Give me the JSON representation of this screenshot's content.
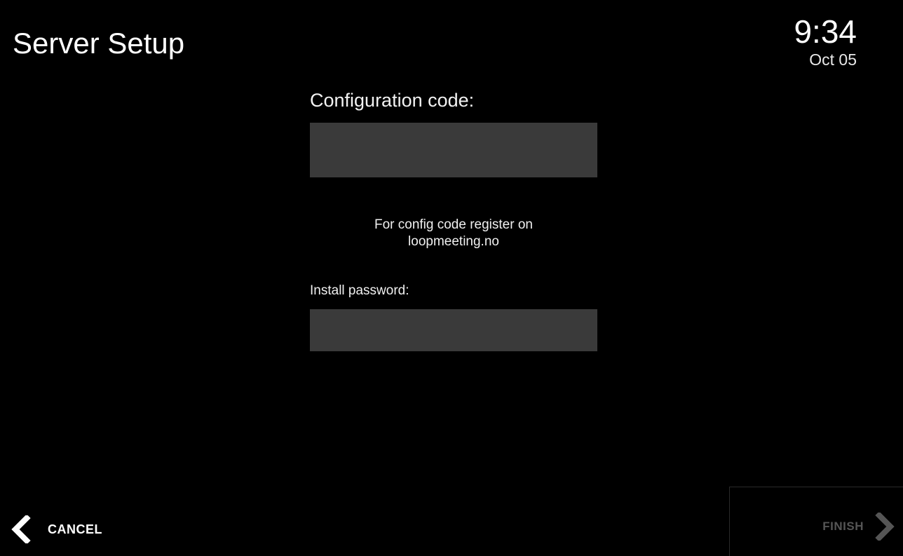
{
  "header": {
    "title": "Server Setup",
    "time": "9:34",
    "date": "Oct 05"
  },
  "form": {
    "config_label": "Configuration code:",
    "config_value": "",
    "hint_line1": "For config code register on",
    "hint_line2": "loopmeeting.no",
    "password_label": "Install password:",
    "password_value": ""
  },
  "footer": {
    "cancel_label": "CANCEL",
    "cancel_icon": "chevron-left-icon",
    "finish_label": "FINISH",
    "finish_icon": "chevron-right-icon",
    "finish_enabled": false
  },
  "colors": {
    "background": "#000000",
    "input_background": "#3a3a3a",
    "text": "#ffffff",
    "disabled_text": "#555555"
  }
}
